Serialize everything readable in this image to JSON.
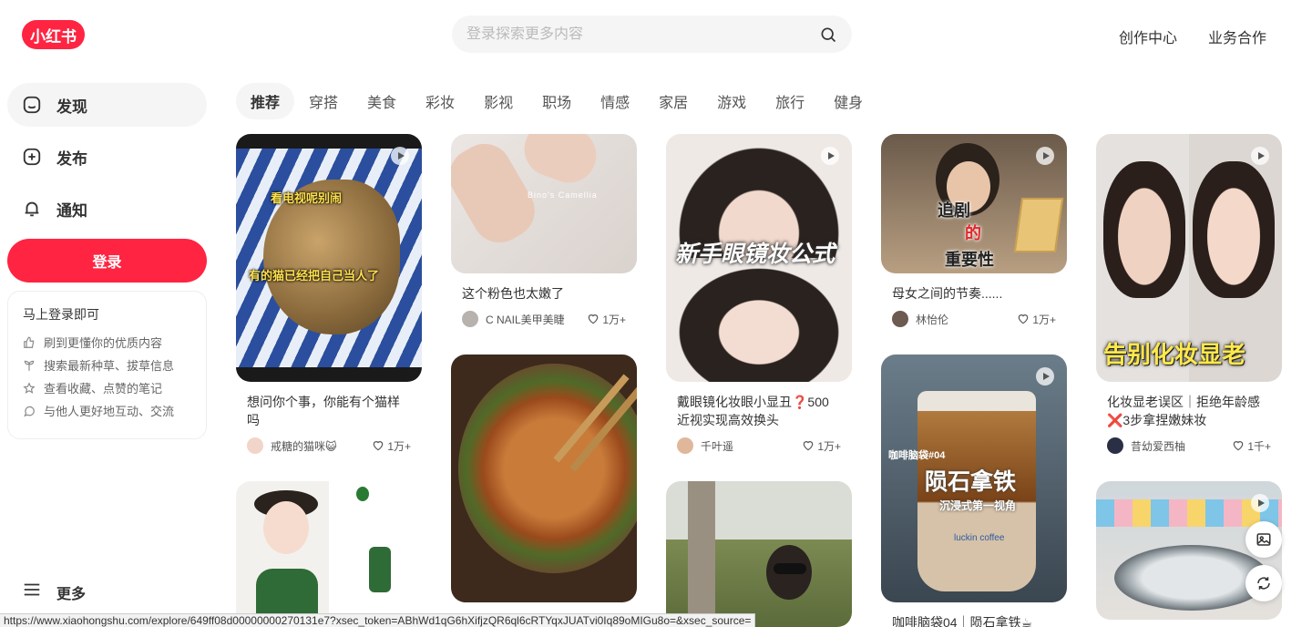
{
  "header": {
    "logo": "小红书",
    "search_placeholder": "登录探索更多内容",
    "links": [
      "创作中心",
      "业务合作"
    ]
  },
  "sidebar": {
    "items": [
      {
        "label": "发现",
        "icon": "home-icon"
      },
      {
        "label": "发布",
        "icon": "plus-square-icon"
      },
      {
        "label": "通知",
        "icon": "bell-icon"
      }
    ],
    "login_label": "登录",
    "promo": {
      "title": "马上登录即可",
      "rows": [
        {
          "text": "刷到更懂你的优质内容",
          "icon": "thumb-icon"
        },
        {
          "text": "搜索最新种草、拔草信息",
          "icon": "search-plant-icon"
        },
        {
          "text": "查看收藏、点赞的笔记",
          "icon": "star-icon"
        },
        {
          "text": "与他人更好地互动、交流",
          "icon": "chat-icon"
        }
      ]
    },
    "more_label": "更多"
  },
  "tabs": [
    "推荐",
    "穿搭",
    "美食",
    "彩妆",
    "影视",
    "职场",
    "情感",
    "家居",
    "游戏",
    "旅行",
    "健身"
  ],
  "cards": [
    {
      "title": "想问你个事，你能有个猫样吗",
      "author": "戒糖的猫咪😺",
      "likes": "1万+",
      "overlay1": "看电视呢别闹",
      "overlay2": "有的猫已经把自己当人了",
      "video": true
    },
    {
      "title": "这个粉色也太嫩了",
      "author": "C NAIL美甲美睫",
      "likes": "1万+",
      "overlay1": "Bino's Camellia",
      "video": false
    },
    {
      "title": "戴眼镜化妆眼小显丑❓500近视实现高效换头",
      "author": "千叶遥",
      "likes": "1万+",
      "overlay1": "新手眼镜妆公式",
      "video": true
    },
    {
      "title": "母女之间的节奏......",
      "author": "林怡伦",
      "likes": "1万+",
      "overlay1": "追剧",
      "overlay2": "的",
      "overlay3": "重要性",
      "video": true
    },
    {
      "title": "化妆显老误区｜拒绝年龄感❌3步拿捏嫩妹妆",
      "author": "昔幼爱西柚",
      "likes": "1千+",
      "overlay1": "告别化妆显老",
      "video": true
    },
    {
      "title": "",
      "author": "",
      "likes": "",
      "video": false
    },
    {
      "title": "",
      "author": "",
      "likes": "",
      "video": false
    },
    {
      "title": "",
      "author": "",
      "likes": "",
      "video": false
    },
    {
      "title": "咖啡脑袋04｜陨石拿铁☕",
      "author": "",
      "likes": "",
      "overlay1": "咖啡脑袋#04",
      "overlay2": "陨石拿铁",
      "overlay3": "沉浸式第一视角",
      "overlay4": "luckin coffee",
      "video": true
    },
    {
      "title": "",
      "author": "",
      "likes": "",
      "video": true
    }
  ],
  "status_url": "https://www.xiaohongshu.com/explore/649ff08d00000000270131e7?xsec_token=ABhWd1qG6hXifjzQR6ql6cRTYqxJUATvi0Iq89oMIGu8o=&xsec_source=",
  "colors": {
    "brand": "#ff2442",
    "text": "#333333",
    "muted": "#555555"
  }
}
